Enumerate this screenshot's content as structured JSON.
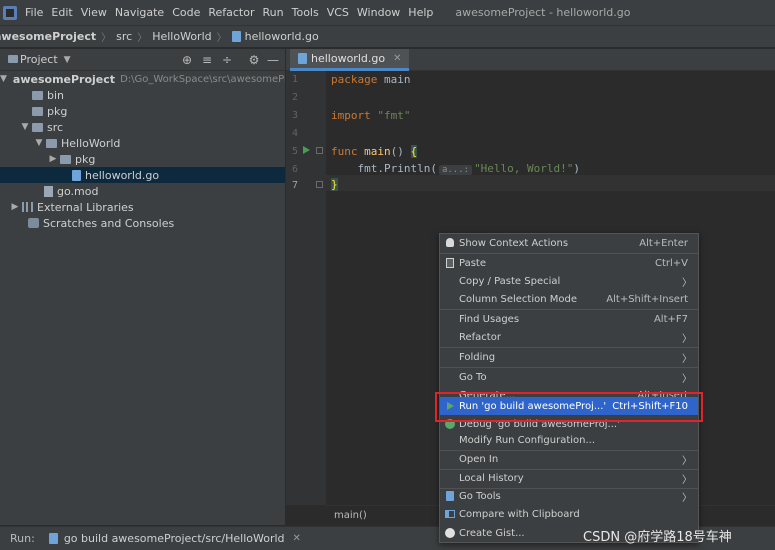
{
  "window": {
    "title": "awesomeProject - helloworld.go",
    "menu": [
      "File",
      "Edit",
      "View",
      "Navigate",
      "Code",
      "Refactor",
      "Run",
      "Tools",
      "VCS",
      "Window",
      "Help"
    ]
  },
  "navbar": {
    "crumbs": [
      "awesomeProject",
      "src",
      "HelloWorld",
      "helloworld.go"
    ]
  },
  "project_panel": {
    "label": "Project",
    "tree": [
      {
        "text": "awesomeProject",
        "path": "D:\\Go_WorkSpace\\src\\awesomePr",
        "depth": 0,
        "arrow": "▼",
        "type": "folder",
        "bold": true
      },
      {
        "text": "bin",
        "depth": 1,
        "arrow": "",
        "type": "folder"
      },
      {
        "text": "pkg",
        "depth": 1,
        "arrow": "",
        "type": "folder"
      },
      {
        "text": "src",
        "depth": 1,
        "arrow": "▼",
        "type": "folder"
      },
      {
        "text": "HelloWorld",
        "depth": 2,
        "arrow": "▼",
        "type": "folder"
      },
      {
        "text": "pkg",
        "depth": 3,
        "arrow": "▶",
        "type": "folder"
      },
      {
        "text": "helloworld.go",
        "depth": 4,
        "arrow": "",
        "type": "go",
        "selected": true
      },
      {
        "text": "go.mod",
        "depth": 1,
        "arrow": "",
        "type": "mod"
      },
      {
        "text": "External Libraries",
        "depth": 0,
        "arrow": "▶",
        "type": "lib"
      },
      {
        "text": "Scratches and Consoles",
        "depth": 0,
        "arrow": "",
        "type": "scratch"
      }
    ]
  },
  "editor": {
    "tab_label": "helloworld.go",
    "line_numbers": [
      "1",
      "2",
      "3",
      "4",
      "5",
      "6",
      "7"
    ],
    "code": {
      "l1_kw": "package",
      "l1_rest": " main",
      "l3_kw": "import",
      "l3_str": "\"fmt\"",
      "l5_kw": "func",
      "l5_fn": "main",
      "l5_rest": "() ",
      "l5_brace": "{",
      "l6_call": "    fmt.Println(",
      "l6_hint": "a...:",
      "l6_str": "\"Hello, World!\"",
      "l6_end": ")",
      "l7_brace": "}"
    },
    "breadcrumb": "main()"
  },
  "context_menu": {
    "items": [
      {
        "label": "Show Context Actions",
        "shortcut": "Alt+Enter",
        "icon": "bulb-icon",
        "sub": false
      },
      {
        "label": "Paste",
        "shortcut": "Ctrl+V",
        "icon": "paste-icon",
        "sub": false
      },
      {
        "label": "Copy / Paste Special",
        "shortcut": "",
        "icon": "",
        "sub": true
      },
      {
        "label": "Column Selection Mode",
        "shortcut": "Alt+Shift+Insert",
        "icon": "",
        "sub": false
      },
      {
        "label": "Find Usages",
        "shortcut": "Alt+F7",
        "icon": "",
        "sub": false
      },
      {
        "label": "Refactor",
        "shortcut": "",
        "icon": "",
        "sub": true
      },
      {
        "label": "Folding",
        "shortcut": "",
        "icon": "",
        "sub": true
      },
      {
        "label": "Go To",
        "shortcut": "",
        "icon": "",
        "sub": true
      },
      {
        "label": "Generate...",
        "shortcut": "Alt+Insert",
        "icon": "",
        "sub": false
      },
      {
        "label": "Run 'go build awesomeProj...'",
        "shortcut": "Ctrl+Shift+F10",
        "icon": "run-icon",
        "sub": false,
        "highlighted": true
      },
      {
        "label": "Debug 'go build awesomeProj...'",
        "shortcut": "",
        "icon": "debug-icon",
        "sub": false
      },
      {
        "label": "Modify Run Configuration...",
        "shortcut": "",
        "icon": "",
        "sub": false
      },
      {
        "label": "Open In",
        "shortcut": "",
        "icon": "",
        "sub": true
      },
      {
        "label": "Local History",
        "shortcut": "",
        "icon": "",
        "sub": true
      },
      {
        "label": "Go Tools",
        "shortcut": "",
        "icon": "gotools-icon",
        "sub": true
      },
      {
        "label": "Compare with Clipboard",
        "shortcut": "",
        "icon": "compare-icon",
        "sub": false
      },
      {
        "label": "Create Gist...",
        "shortcut": "",
        "icon": "github-icon",
        "sub": false
      }
    ]
  },
  "runbar": {
    "label": "Run:",
    "tab_label": "go build awesomeProject/src/HelloWorld"
  },
  "watermark": "CSDN @府学路18号车神",
  "colors": {
    "accent": "#2f65ca",
    "highlight_box": "#e0242c",
    "keyword": "#cc7832",
    "string": "#6a8759",
    "function": "#ffc66d"
  }
}
